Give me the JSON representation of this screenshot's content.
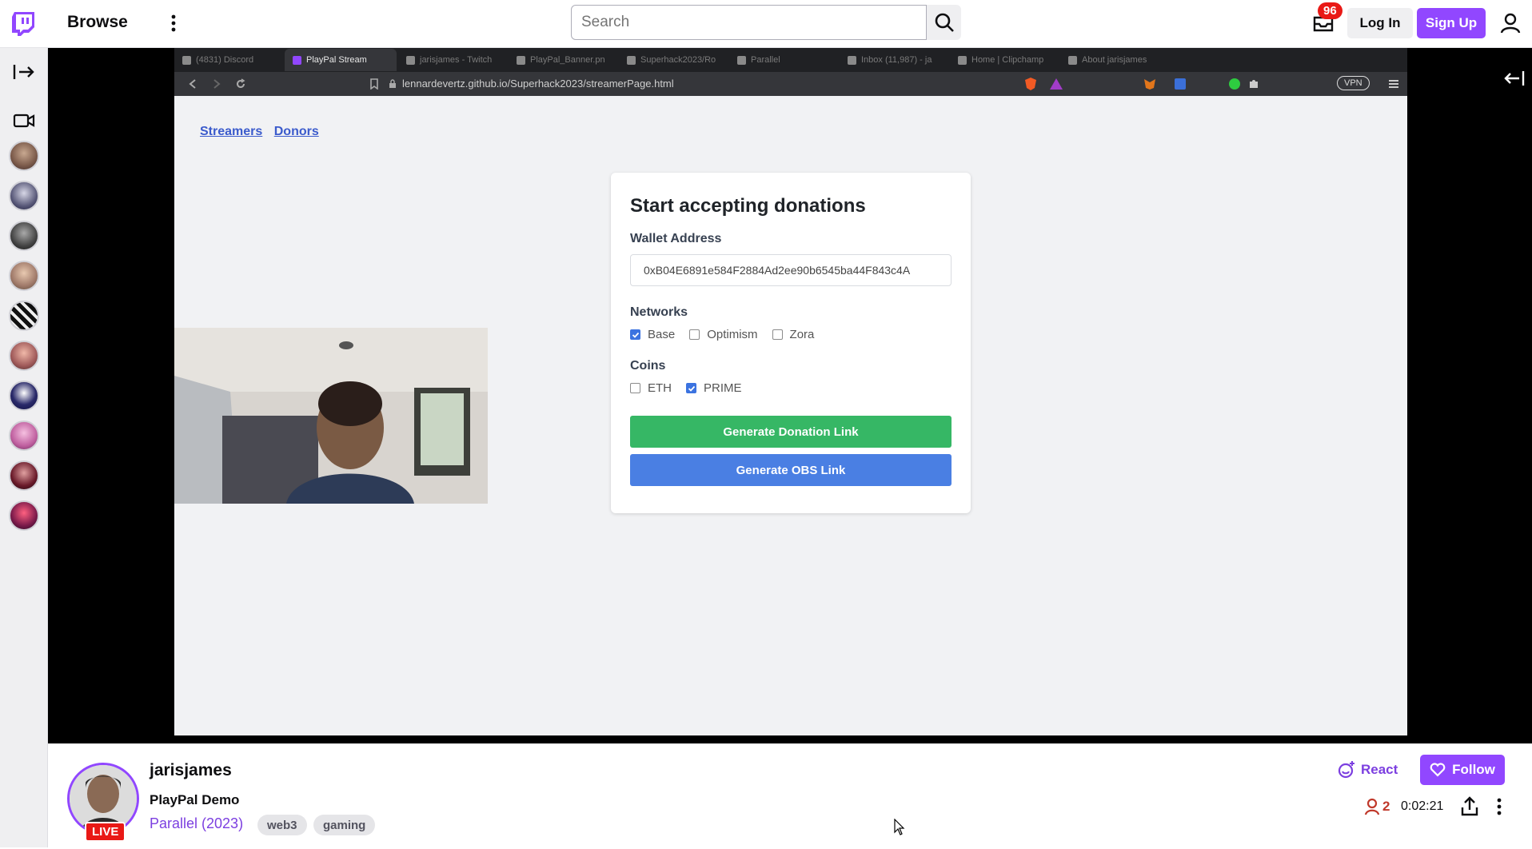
{
  "topnav": {
    "browse_label": "Browse",
    "search_placeholder": "Search",
    "inbox_count": "96",
    "login_label": "Log In",
    "signup_label": "Sign Up"
  },
  "browser": {
    "tabs": [
      {
        "label": "(4831) Discord",
        "active": false
      },
      {
        "label": "PlayPal Stream",
        "active": true
      },
      {
        "label": "jarisjames - Twitch",
        "active": false
      },
      {
        "label": "PlayPal_Banner.pn",
        "active": false
      },
      {
        "label": "Superhack2023/Ro",
        "active": false
      },
      {
        "label": "Parallel",
        "active": false
      },
      {
        "label": "Inbox (11,987) - ja",
        "active": false
      },
      {
        "label": "Home | Clipchamp",
        "active": false
      },
      {
        "label": "About jarisjames",
        "active": false
      }
    ],
    "url": "lennardevertz.github.io/Superhack2023/streamerPage.html",
    "vpn_label": "VPN"
  },
  "page": {
    "links": [
      "Streamers",
      "Donors"
    ],
    "card_title": "Start accepting donations",
    "wallet_label": "Wallet Address",
    "wallet_value": "0xB04E6891e584F2884Ad2ee90b6545ba44F843c4A",
    "networks_label": "Networks",
    "networks": [
      {
        "label": "Base",
        "checked": true
      },
      {
        "label": "Optimism",
        "checked": false
      },
      {
        "label": "Zora",
        "checked": false
      }
    ],
    "coins_label": "Coins",
    "coins": [
      {
        "label": "ETH",
        "checked": false
      },
      {
        "label": "PRIME",
        "checked": true
      }
    ],
    "gen_donation_label": "Generate Donation Link",
    "gen_obs_label": "Generate OBS Link"
  },
  "stream": {
    "channel": "jarisjames",
    "title": "PlayPal Demo",
    "game": "Parallel (2023)",
    "tags": [
      "web3",
      "gaming"
    ],
    "live_label": "LIVE",
    "react_label": "React",
    "follow_label": "Follow",
    "viewers": "2",
    "uptime": "0:02:21"
  },
  "colors": {
    "brand": "#9147ff",
    "live": "#e91916",
    "green_btn": "#36b765",
    "blue_btn": "#4a7fe3"
  }
}
